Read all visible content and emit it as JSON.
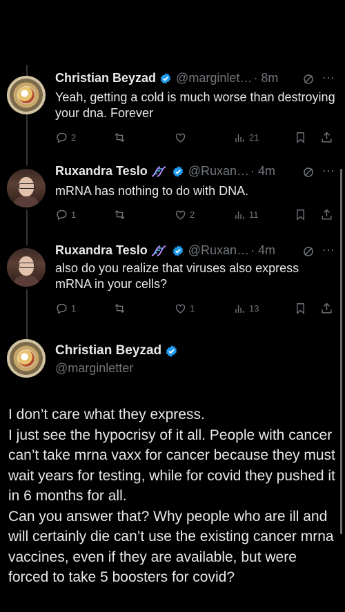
{
  "colors": {
    "background": "#000000",
    "text": "#e7e9ea",
    "muted": "#71767b",
    "verified": "#1d9bf0"
  },
  "replies": [
    {
      "name": "Christian Beyzad",
      "handle": "@marginlet…",
      "time": "· 8m",
      "text": "Yeah, getting a cold is much worse than destroying your dna. Forever",
      "reply_count": "2",
      "repost_count": "",
      "like_count": "",
      "view_count": "21"
    },
    {
      "name": "Ruxandra Teslo",
      "handle": "@Ruxan…",
      "time": "· 4m",
      "text": "mRNA has nothing to do with DNA.",
      "reply_count": "1",
      "repost_count": "",
      "like_count": "2",
      "view_count": "11"
    },
    {
      "name": "Ruxandra Teslo",
      "handle": "@Ruxan…",
      "time": "· 4m",
      "text": "also do you realize that viruses also express mRNA in your cells?",
      "reply_count": "1",
      "repost_count": "",
      "like_count": "1",
      "view_count": "13"
    }
  ],
  "main_tweet": {
    "name": "Christian Beyzad",
    "handle": "@marginletter",
    "lines": [
      "I don’t care what they express.",
      "I just see the hypocrisy of it all. People with cancer can’t take mrna vaxx for cancer because they must wait years for testing, while for covid they pushed it in 6 months for all.",
      "Can you answer that? Why people who are ill and will certainly die can’t use the existing cancer mrna vaccines, even if they are available, but were forced to take 5 boosters for covid?"
    ]
  },
  "icons": [
    "reply-icon",
    "repost-icon",
    "like-icon",
    "views-icon",
    "bookmark-icon",
    "share-icon",
    "grok-icon",
    "more-icon",
    "verified-icon",
    "dna-icon"
  ]
}
